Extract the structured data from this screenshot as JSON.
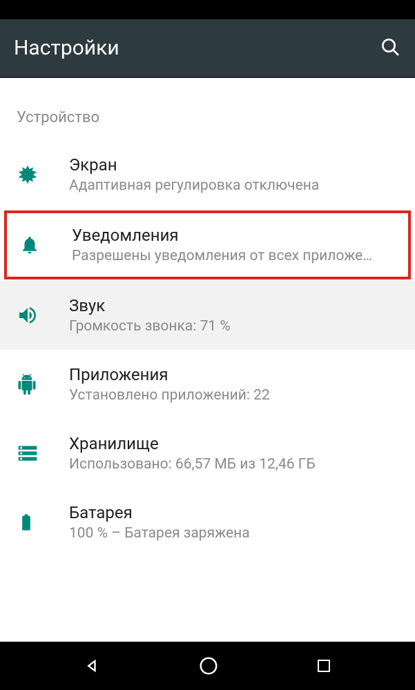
{
  "header": {
    "title": "Настройки"
  },
  "section": {
    "label": "Устройство"
  },
  "items": [
    {
      "title": "Экран",
      "subtitle": "Адаптивная регулировка отключена"
    },
    {
      "title": "Уведомления",
      "subtitle": "Разрешены уведомления от всех приложе…"
    },
    {
      "title": "Звук",
      "subtitle": "Громкость звонка: 71 %"
    },
    {
      "title": "Приложения",
      "subtitle": "Установлено приложений: 22"
    },
    {
      "title": "Хранилище",
      "subtitle": "Использовано: 66,57 МБ из 12,46 ГБ"
    },
    {
      "title": "Батарея",
      "subtitle": "100 % – Батарея заряжена"
    }
  ],
  "colors": {
    "accent": "#00897b",
    "highlight_border": "#d9271c"
  }
}
